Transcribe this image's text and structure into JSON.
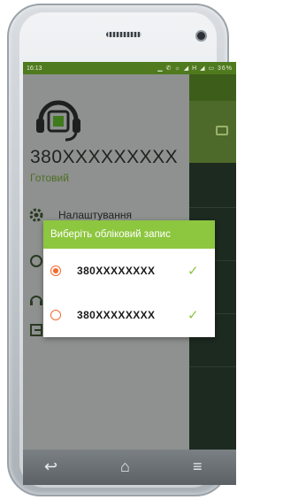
{
  "status_bar": {
    "time": "16:13",
    "icons": "▁ ✆ ☼ ◢ H ◢ ▭ 36%"
  },
  "drawer": {
    "account_number": "380XXXXXXXXX",
    "account_status": "Готовий",
    "items": [
      {
        "label": "Налаштування",
        "icon": "gear-icon"
      },
      {
        "label": "",
        "icon": "circle-icon"
      },
      {
        "label": "",
        "icon": "headset-small-icon"
      },
      {
        "label": "",
        "icon": "exit-icon"
      }
    ],
    "arrow": "›"
  },
  "dialog": {
    "title": "Виберіть обліковий запис",
    "accounts": [
      {
        "number": "380XXXXXXXX",
        "selected": true
      },
      {
        "number": "380XXXXXXXX",
        "selected": false
      }
    ],
    "check_glyph": "✓"
  },
  "nav": {
    "back": "↩",
    "home": "⌂",
    "menu": "≡"
  },
  "colors": {
    "accent_green": "#8dc63f",
    "status_green": "#4f7a1e",
    "radio_orange": "#f26a2f"
  }
}
